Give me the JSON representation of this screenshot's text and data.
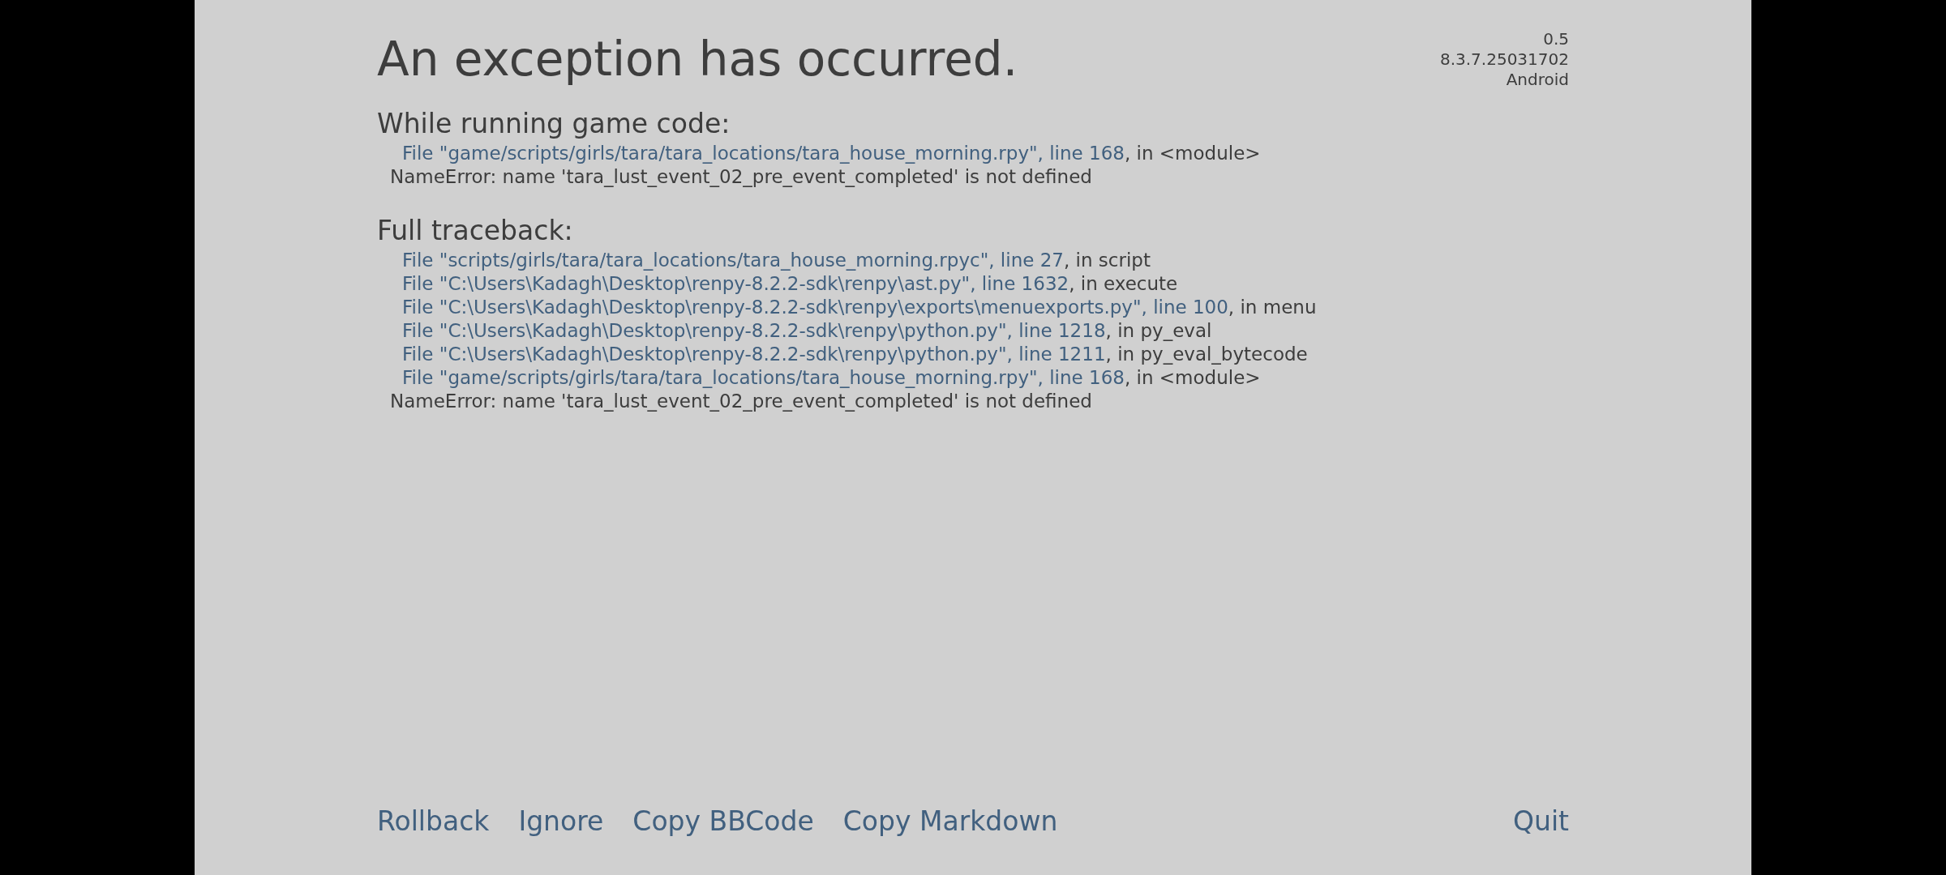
{
  "title": "An exception has occurred.",
  "version_info": [
    "0.5",
    "8.3.7.25031702",
    "Android"
  ],
  "game_code": {
    "heading": "While running game code:",
    "frames": [
      {
        "location": "File \"game/scripts/girls/tara/tara_locations/tara_house_morning.rpy\", line 168",
        "detail": ", in <module>"
      }
    ],
    "error": "NameError: name 'tara_lust_event_02_pre_event_completed' is not defined"
  },
  "full_traceback": {
    "heading": "Full traceback:",
    "frames": [
      {
        "location": "File \"scripts/girls/tara/tara_locations/tara_house_morning.rpyc\", line 27",
        "detail": ", in script"
      },
      {
        "location": "File \"C:\\Users\\Kadagh\\Desktop\\renpy-8.2.2-sdk\\renpy\\ast.py\", line 1632",
        "detail": ", in execute"
      },
      {
        "location": "File \"C:\\Users\\Kadagh\\Desktop\\renpy-8.2.2-sdk\\renpy\\exports\\menuexports.py\", line 100",
        "detail": ", in menu"
      },
      {
        "location": "File \"C:\\Users\\Kadagh\\Desktop\\renpy-8.2.2-sdk\\renpy\\python.py\", line 1218",
        "detail": ", in py_eval"
      },
      {
        "location": "File \"C:\\Users\\Kadagh\\Desktop\\renpy-8.2.2-sdk\\renpy\\python.py\", line 1211",
        "detail": ", in py_eval_bytecode"
      },
      {
        "location": "File \"game/scripts/girls/tara/tara_locations/tara_house_morning.rpy\", line 168",
        "detail": ", in <module>"
      }
    ],
    "error": "NameError: name 'tara_lust_event_02_pre_event_completed' is not defined"
  },
  "actions": [
    "Rollback",
    "Ignore",
    "Copy BBCode",
    "Copy Markdown"
  ],
  "quit": "Quit"
}
